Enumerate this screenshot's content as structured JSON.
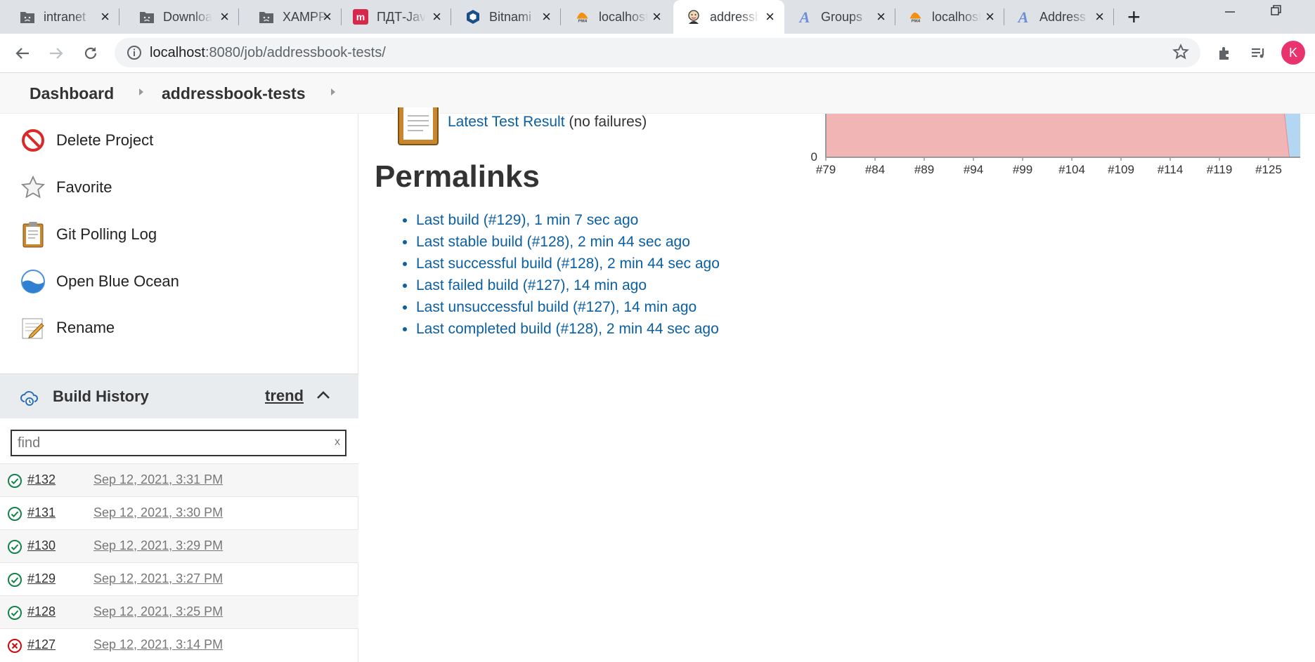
{
  "browser": {
    "tabs": [
      {
        "title": "intranet",
        "icon": "folder-sad-icon",
        "active": false
      },
      {
        "title": "Downloads",
        "icon": "folder-sad-icon",
        "active": false
      },
      {
        "title": "XAMPP",
        "icon": "folder-sad-icon",
        "active": false
      },
      {
        "title": "ПДТ-Java",
        "icon": "mantis-icon",
        "active": false
      },
      {
        "title": "Bitnami",
        "icon": "bitnami-icon",
        "active": false
      },
      {
        "title": "localhost",
        "icon": "pma-icon",
        "active": false
      },
      {
        "title": "addressbook",
        "icon": "jenkins-icon",
        "active": true
      },
      {
        "title": "Groups",
        "icon": "a-icon",
        "active": false
      },
      {
        "title": "localhost",
        "icon": "pma-icon",
        "active": false
      },
      {
        "title": "Address",
        "icon": "a-icon",
        "active": false
      }
    ],
    "url_host": "localhost",
    "url_rest": ":8080/job/addressbook-tests/",
    "profile_initial": "K",
    "colors": {
      "accent": "#e8336f",
      "link": "#0b5fa3"
    }
  },
  "breadcrumb": {
    "dashboard": "Dashboard",
    "job": "addressbook-tests"
  },
  "sidebar": {
    "tasks": [
      {
        "label": "Delete Project",
        "icon": "delete-icon"
      },
      {
        "label": "Favorite",
        "icon": "star-icon"
      },
      {
        "label": "Git Polling Log",
        "icon": "clipboard-icon"
      },
      {
        "label": "Open Blue Ocean",
        "icon": "blue-ocean-icon"
      },
      {
        "label": "Rename",
        "icon": "notepad-icon"
      }
    ],
    "build_history": {
      "title": "Build History",
      "trend": "trend",
      "find_placeholder": "find",
      "clear": "x",
      "builds": [
        {
          "number": "#132",
          "date": "Sep 12, 2021, 3:31 PM",
          "status": "success"
        },
        {
          "number": "#131",
          "date": "Sep 12, 2021, 3:30 PM",
          "status": "success"
        },
        {
          "number": "#130",
          "date": "Sep 12, 2021, 3:29 PM",
          "status": "success"
        },
        {
          "number": "#129",
          "date": "Sep 12, 2021, 3:27 PM",
          "status": "success"
        },
        {
          "number": "#128",
          "date": "Sep 12, 2021, 3:25 PM",
          "status": "success"
        },
        {
          "number": "#127",
          "date": "Sep 12, 2021, 3:14 PM",
          "status": "failed"
        }
      ]
    }
  },
  "main": {
    "latest_test_link": "Latest Test Result",
    "latest_test_note": "(no failures)",
    "permalinks_title": "Permalinks",
    "permalinks": [
      "Last build (#129), 1 min 7 sec ago",
      "Last stable build (#128), 2 min 44 sec ago",
      "Last successful build (#128), 2 min 44 sec ago",
      "Last failed build (#127), 14 min ago",
      "Last unsuccessful build (#127), 14 min ago",
      "Last completed build (#128), 2 min 44 sec ago"
    ]
  },
  "chart_data": {
    "type": "area",
    "x": [
      "#79",
      "#84",
      "#89",
      "#94",
      "#99",
      "#104",
      "#109",
      "#114",
      "#119",
      "#125"
    ],
    "y_tick_label": "0",
    "series": [
      {
        "color": "#f2b5b5"
      },
      {
        "color": "#b3d7f2"
      }
    ]
  }
}
